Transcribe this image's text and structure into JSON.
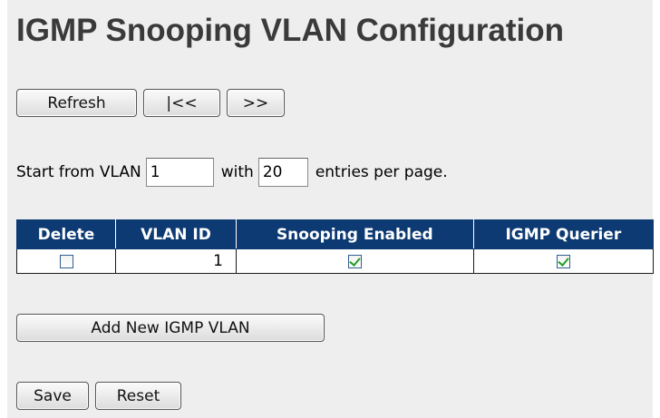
{
  "page": {
    "title": "IGMP Snooping VLAN Configuration"
  },
  "nav": {
    "refresh_label": "Refresh",
    "first_label": "|<<",
    "next_label": ">>"
  },
  "paging": {
    "start_from_label": "Start from VLAN",
    "start_vlan": "1",
    "with_label": "with",
    "entries": "20",
    "entries_suffix": "entries per page."
  },
  "table": {
    "headers": [
      "Delete",
      "VLAN ID",
      "Snooping Enabled",
      "IGMP Querier"
    ],
    "rows": [
      {
        "delete": false,
        "vlan_id": "1",
        "snooping_enabled": true,
        "igmp_querier": true
      }
    ]
  },
  "actions": {
    "add_label": "Add New IGMP VLAN",
    "save_label": "Save",
    "reset_label": "Reset"
  },
  "colors": {
    "header_bg": "#0d3a73",
    "panel_bg": "#eeeeee",
    "check": "#21a121"
  }
}
